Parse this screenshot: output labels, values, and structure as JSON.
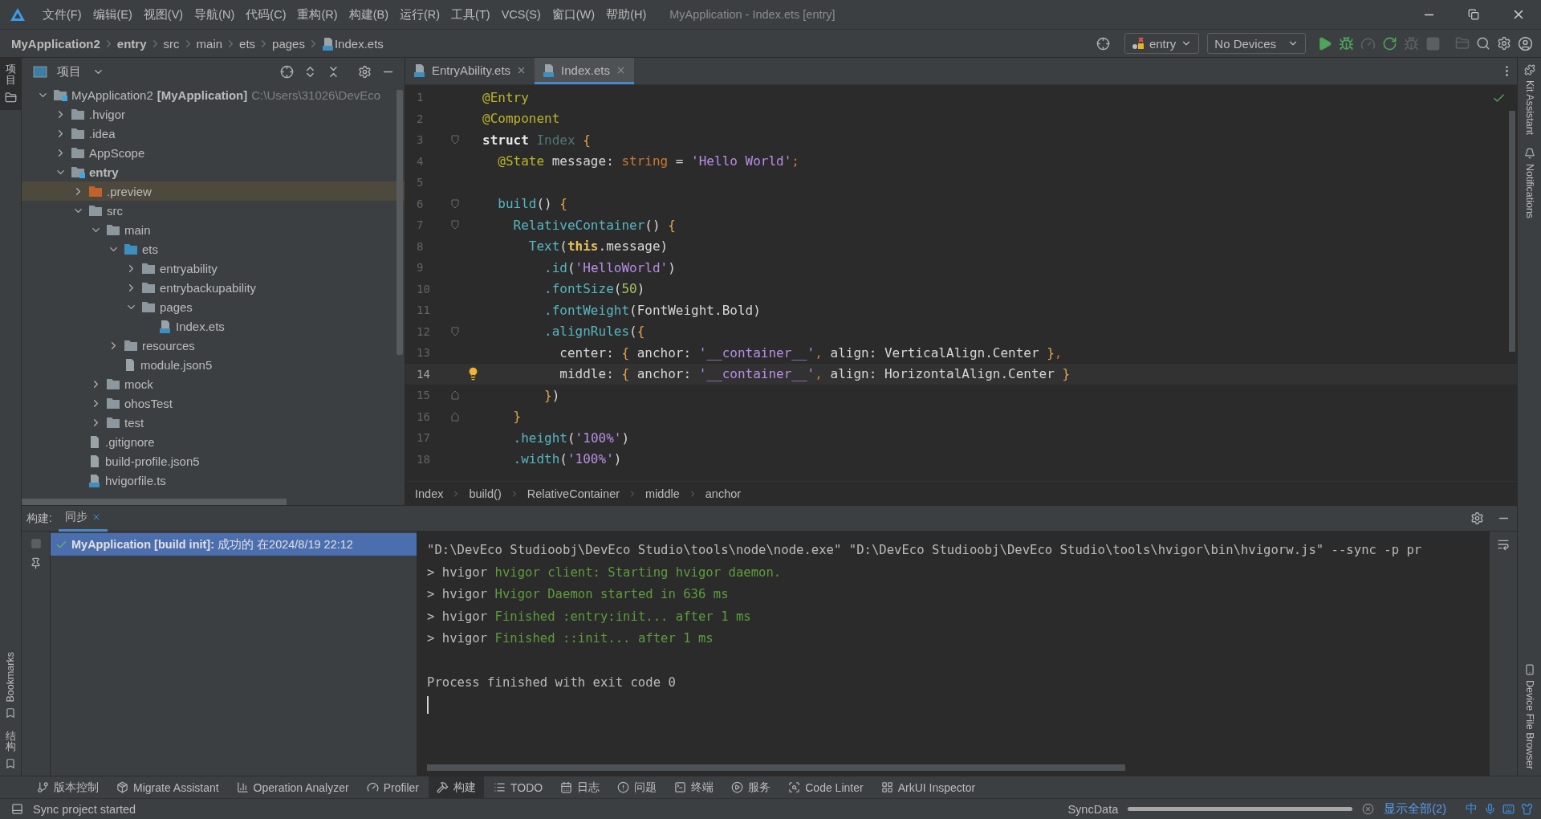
{
  "window": {
    "title": "MyApplication - Index.ets [entry]"
  },
  "menu": [
    "文件(F)",
    "编辑(E)",
    "视图(V)",
    "导航(N)",
    "代码(C)",
    "重构(R)",
    "构建(B)",
    "运行(R)",
    "工具(T)",
    "VCS(S)",
    "窗口(W)",
    "帮助(H)"
  ],
  "breadcrumbs": [
    {
      "label": "MyApplication2",
      "kind": "module"
    },
    {
      "label": "entry",
      "kind": "module"
    },
    {
      "label": "src",
      "kind": "dir"
    },
    {
      "label": "main",
      "kind": "dir"
    },
    {
      "label": "ets",
      "kind": "dir"
    },
    {
      "label": "pages",
      "kind": "dir"
    },
    {
      "label": "Index.ets",
      "kind": "file"
    }
  ],
  "toolbar": {
    "run_config": "entry",
    "device": "No Devices",
    "actions": [
      {
        "kind": "run",
        "disabled": false
      },
      {
        "kind": "debug",
        "disabled": false
      },
      {
        "kind": "profile",
        "disabled": true
      },
      {
        "kind": "apply",
        "disabled": false
      },
      {
        "kind": "attach",
        "disabled": true
      },
      {
        "kind": "stop",
        "disabled": true
      }
    ]
  },
  "left_tool_windows": {
    "top": [
      {
        "label": "项目",
        "selected": true
      }
    ],
    "bottom": [
      {
        "label": "Bookmarks",
        "selected": false
      },
      {
        "label": "结构",
        "selected": false
      }
    ]
  },
  "right_tool_windows": {
    "top": [
      {
        "label": "Kit Assistant",
        "kind": "kit"
      },
      {
        "label": "Notifications",
        "kind": "bell"
      }
    ],
    "bottom": [
      {
        "label": "Device File Browser",
        "kind": "device"
      }
    ]
  },
  "project": {
    "title": "项目",
    "tree": [
      {
        "name": "MyApplication2",
        "tag": "[MyApplication]",
        "path": "C:\\Users\\31026\\DevEco",
        "kind": "module",
        "expanded": true,
        "selected": false,
        "children": [
          {
            "name": ".hvigor",
            "kind": "folder",
            "expanded": false,
            "selected": false
          },
          {
            "name": ".idea",
            "kind": "folder",
            "expanded": false,
            "selected": false
          },
          {
            "name": "AppScope",
            "kind": "folder",
            "expanded": false,
            "selected": false
          },
          {
            "name": "entry",
            "kind": "module",
            "expanded": true,
            "selected": false,
            "children": [
              {
                "name": ".preview",
                "kind": "generated",
                "expanded": false,
                "selected": true
              },
              {
                "name": "src",
                "kind": "folder",
                "expanded": true,
                "selected": false,
                "children": [
                  {
                    "name": "main",
                    "kind": "folder",
                    "expanded": true,
                    "selected": false,
                    "children": [
                      {
                        "name": "ets",
                        "kind": "source",
                        "expanded": true,
                        "selected": false,
                        "children": [
                          {
                            "name": "entryability",
                            "kind": "folder",
                            "expanded": false,
                            "selected": false
                          },
                          {
                            "name": "entrybackupability",
                            "kind": "folder",
                            "expanded": false,
                            "selected": false
                          },
                          {
                            "name": "pages",
                            "kind": "folder",
                            "expanded": true,
                            "selected": false,
                            "children": [
                              {
                                "name": "Index.ets",
                                "kind": "ets",
                                "selected": false
                              }
                            ]
                          }
                        ]
                      },
                      {
                        "name": "resources",
                        "kind": "folder",
                        "expanded": false,
                        "selected": false
                      },
                      {
                        "name": "module.json5",
                        "kind": "json",
                        "selected": false
                      }
                    ]
                  },
                  {
                    "name": "mock",
                    "kind": "folder",
                    "expanded": false,
                    "selected": false
                  },
                  {
                    "name": "ohosTest",
                    "kind": "folder",
                    "expanded": false,
                    "selected": false
                  },
                  {
                    "name": "test",
                    "kind": "folder",
                    "expanded": false,
                    "selected": false
                  }
                ]
              },
              {
                "name": ".gitignore",
                "kind": "ignore",
                "selected": false
              },
              {
                "name": "build-profile.json5",
                "kind": "json",
                "selected": false
              },
              {
                "name": "hvigorfile.ts",
                "kind": "ts",
                "selected": false
              }
            ]
          }
        ]
      }
    ]
  },
  "editor": {
    "tabs": [
      {
        "label": "EntryAbility.ets",
        "selected": false
      },
      {
        "label": "Index.ets",
        "selected": true
      }
    ],
    "lines": [
      {
        "number": "1",
        "current": false,
        "tokens": [
          {
            "t": "@Entry",
            "kind": "annotation"
          }
        ]
      },
      {
        "number": "2",
        "current": false,
        "tokens": [
          {
            "t": "@Component",
            "kind": "annotation"
          }
        ]
      },
      {
        "number": "3",
        "current": false,
        "fold_open": true,
        "tokens": [
          {
            "t": "struct",
            "kind": "keyword"
          },
          {
            "t": " Index ",
            "kind": "typename"
          },
          {
            "t": "{",
            "kind": "brace"
          }
        ]
      },
      {
        "number": "4",
        "current": false,
        "tokens": [
          {
            "t": "  @State",
            "kind": "annotation"
          },
          {
            "t": " message: ",
            "kind": "plain"
          },
          {
            "t": "string",
            "kind": "type"
          },
          {
            "t": " = ",
            "kind": "plain"
          },
          {
            "t": "'Hello World'",
            "kind": "string"
          },
          {
            "t": ";",
            "kind": "punct"
          }
        ]
      },
      {
        "number": "5",
        "current": false
      },
      {
        "number": "6",
        "current": false,
        "fold_open": true,
        "tokens": [
          {
            "t": "  build",
            "kind": "func"
          },
          {
            "t": "() ",
            "kind": "plain"
          },
          {
            "t": "{",
            "kind": "brace"
          }
        ]
      },
      {
        "number": "7",
        "current": false,
        "fold_open": true,
        "tokens": [
          {
            "t": "    RelativeContainer",
            "kind": "func"
          },
          {
            "t": "() ",
            "kind": "plain"
          },
          {
            "t": "{",
            "kind": "brace"
          }
        ]
      },
      {
        "number": "8",
        "current": false,
        "tokens": [
          {
            "t": "      Text",
            "kind": "func"
          },
          {
            "t": "(",
            "kind": "plain"
          },
          {
            "t": "this",
            "kind": "this"
          },
          {
            "t": ".message)",
            "kind": "plain"
          }
        ]
      },
      {
        "number": "9",
        "current": false,
        "tokens": [
          {
            "t": "        .id",
            "kind": "func"
          },
          {
            "t": "(",
            "kind": "plain"
          },
          {
            "t": "'HelloWorld'",
            "kind": "string"
          },
          {
            "t": ")",
            "kind": "plain"
          }
        ]
      },
      {
        "number": "10",
        "current": false,
        "tokens": [
          {
            "t": "        .fontSize",
            "kind": "func"
          },
          {
            "t": "(",
            "kind": "plain"
          },
          {
            "t": "50",
            "kind": "number"
          },
          {
            "t": ")",
            "kind": "plain"
          }
        ]
      },
      {
        "number": "11",
        "current": false,
        "tokens": [
          {
            "t": "        .fontWeight",
            "kind": "func"
          },
          {
            "t": "(FontWeight.Bold)",
            "kind": "plain"
          }
        ]
      },
      {
        "number": "12",
        "current": false,
        "fold_open": true,
        "tokens": [
          {
            "t": "        .alignRules",
            "kind": "func"
          },
          {
            "t": "(",
            "kind": "plain"
          },
          {
            "t": "{",
            "kind": "brace"
          }
        ]
      },
      {
        "number": "13",
        "current": false,
        "tokens": [
          {
            "t": "          center: ",
            "kind": "plain"
          },
          {
            "t": "{",
            "kind": "brace"
          },
          {
            "t": " anchor: ",
            "kind": "plain"
          },
          {
            "t": "'__container__'",
            "kind": "string"
          },
          {
            "t": ", ",
            "kind": "punct"
          },
          {
            "t": "align: VerticalAlign.Center ",
            "kind": "plain"
          },
          {
            "t": "}",
            "kind": "brace"
          },
          {
            "t": ",",
            "kind": "punct"
          }
        ]
      },
      {
        "number": "14",
        "current": true,
        "bulb": true,
        "tokens": [
          {
            "t": "          middle: ",
            "kind": "plain"
          },
          {
            "t": "{",
            "kind": "brace"
          },
          {
            "t": " anchor: ",
            "kind": "plain"
          },
          {
            "t": "'__container__'",
            "kind": "string"
          },
          {
            "t": ", ",
            "kind": "punct"
          },
          {
            "t": "align: HorizontalAlign.Center ",
            "kind": "plain"
          },
          {
            "t": "}",
            "kind": "brace"
          }
        ]
      },
      {
        "number": "15",
        "current": false,
        "fold_close": true,
        "tokens": [
          {
            "t": "        }",
            "kind": "brace"
          },
          {
            "t": ")",
            "kind": "plain"
          }
        ]
      },
      {
        "number": "16",
        "current": false,
        "fold_close": true,
        "tokens": [
          {
            "t": "    }",
            "kind": "brace"
          }
        ]
      },
      {
        "number": "17",
        "current": false,
        "tokens": [
          {
            "t": "    .height",
            "kind": "func"
          },
          {
            "t": "(",
            "kind": "plain"
          },
          {
            "t": "'100%'",
            "kind": "string"
          },
          {
            "t": ")",
            "kind": "plain"
          }
        ]
      },
      {
        "number": "18",
        "current": false,
        "tokens": [
          {
            "t": "    .width",
            "kind": "func"
          },
          {
            "t": "(",
            "kind": "plain"
          },
          {
            "t": "'100%'",
            "kind": "string"
          },
          {
            "t": ")",
            "kind": "plain"
          }
        ]
      }
    ],
    "breadcrumbs": [
      "Index",
      "build()",
      "RelativeContainer",
      "middle",
      "anchor"
    ]
  },
  "build": {
    "label": "构建:",
    "tabs": [
      {
        "label": "同步",
        "selected": true
      }
    ],
    "items": [
      {
        "text": "**MyApplication [build init]:** 成功的 在2024/8/19 22:12",
        "selected": true
      }
    ],
    "console": [
      {
        "kind": "command",
        "text": "\"D:\\DevEco Studioobj\\DevEco Studio\\tools\\node\\node.exe\" \"D:\\DevEco Studioobj\\DevEco Studio\\tools\\hvigor\\bin\\hvigorw.js\" --sync -p pr"
      },
      {
        "kind": "log",
        "prefix": "> hvigor",
        "text": "hvigor client: Starting hvigor daemon."
      },
      {
        "kind": "log",
        "prefix": "> hvigor",
        "text": "Hvigor Daemon started in 636 ms"
      },
      {
        "kind": "log",
        "prefix": "> hvigor",
        "text": "Finished :entry:init... after 1 ms"
      },
      {
        "kind": "log",
        "prefix": "> hvigor",
        "text": "Finished ::init... after 1 ms"
      },
      {
        "kind": "blank"
      },
      {
        "kind": "exit",
        "text": "Process finished with exit code 0"
      },
      {
        "kind": "cursor"
      }
    ]
  },
  "tool_tabs": [
    {
      "label": "版本控制",
      "kind": "vcs",
      "selected": false
    },
    {
      "label": "Migrate Assistant",
      "kind": "migrate",
      "selected": false
    },
    {
      "label": "Operation Analyzer",
      "kind": "analyzer",
      "selected": false
    },
    {
      "label": "Profiler",
      "kind": "profiler",
      "selected": false
    },
    {
      "label": "构建",
      "kind": "build",
      "selected": true
    },
    {
      "label": "TODO",
      "kind": "todo",
      "selected": false
    },
    {
      "label": "日志",
      "kind": "log",
      "selected": false
    },
    {
      "label": "问题",
      "kind": "problems",
      "selected": false
    },
    {
      "label": "终端",
      "kind": "terminal",
      "selected": false
    },
    {
      "label": "服务",
      "kind": "services",
      "selected": false
    },
    {
      "label": "Code Linter",
      "kind": "linter",
      "selected": false
    },
    {
      "label": "ArkUI Inspector",
      "kind": "inspector",
      "selected": false
    }
  ],
  "status_bar": {
    "message": "Sync project started",
    "task": "SyncData",
    "level": 1,
    "link": "显示全部(2)",
    "ime": "中"
  }
}
